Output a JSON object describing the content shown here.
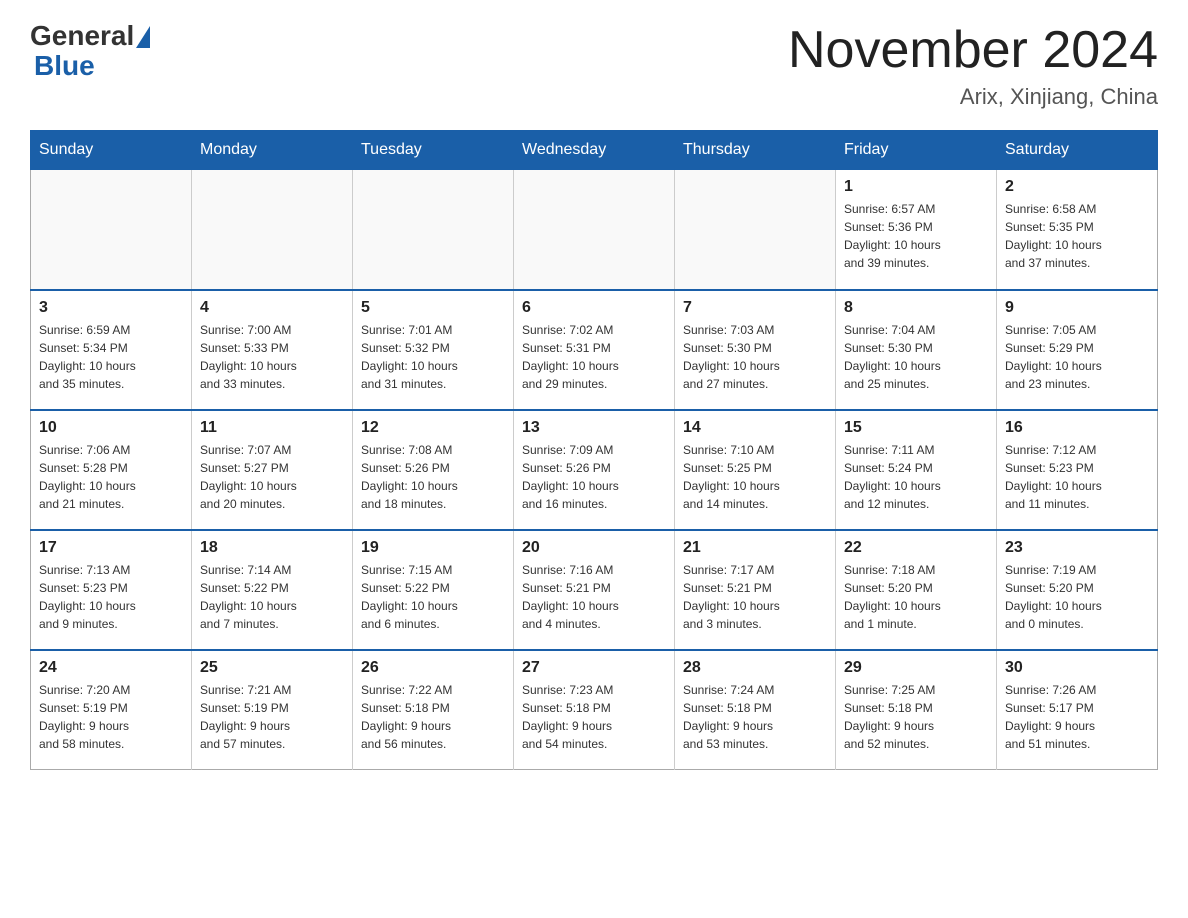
{
  "header": {
    "logo_general": "General",
    "logo_blue": "Blue",
    "month_title": "November 2024",
    "location": "Arix, Xinjiang, China"
  },
  "weekdays": [
    "Sunday",
    "Monday",
    "Tuesday",
    "Wednesday",
    "Thursday",
    "Friday",
    "Saturday"
  ],
  "weeks": [
    [
      {
        "day": "",
        "info": ""
      },
      {
        "day": "",
        "info": ""
      },
      {
        "day": "",
        "info": ""
      },
      {
        "day": "",
        "info": ""
      },
      {
        "day": "",
        "info": ""
      },
      {
        "day": "1",
        "info": "Sunrise: 6:57 AM\nSunset: 5:36 PM\nDaylight: 10 hours\nand 39 minutes."
      },
      {
        "day": "2",
        "info": "Sunrise: 6:58 AM\nSunset: 5:35 PM\nDaylight: 10 hours\nand 37 minutes."
      }
    ],
    [
      {
        "day": "3",
        "info": "Sunrise: 6:59 AM\nSunset: 5:34 PM\nDaylight: 10 hours\nand 35 minutes."
      },
      {
        "day": "4",
        "info": "Sunrise: 7:00 AM\nSunset: 5:33 PM\nDaylight: 10 hours\nand 33 minutes."
      },
      {
        "day": "5",
        "info": "Sunrise: 7:01 AM\nSunset: 5:32 PM\nDaylight: 10 hours\nand 31 minutes."
      },
      {
        "day": "6",
        "info": "Sunrise: 7:02 AM\nSunset: 5:31 PM\nDaylight: 10 hours\nand 29 minutes."
      },
      {
        "day": "7",
        "info": "Sunrise: 7:03 AM\nSunset: 5:30 PM\nDaylight: 10 hours\nand 27 minutes."
      },
      {
        "day": "8",
        "info": "Sunrise: 7:04 AM\nSunset: 5:30 PM\nDaylight: 10 hours\nand 25 minutes."
      },
      {
        "day": "9",
        "info": "Sunrise: 7:05 AM\nSunset: 5:29 PM\nDaylight: 10 hours\nand 23 minutes."
      }
    ],
    [
      {
        "day": "10",
        "info": "Sunrise: 7:06 AM\nSunset: 5:28 PM\nDaylight: 10 hours\nand 21 minutes."
      },
      {
        "day": "11",
        "info": "Sunrise: 7:07 AM\nSunset: 5:27 PM\nDaylight: 10 hours\nand 20 minutes."
      },
      {
        "day": "12",
        "info": "Sunrise: 7:08 AM\nSunset: 5:26 PM\nDaylight: 10 hours\nand 18 minutes."
      },
      {
        "day": "13",
        "info": "Sunrise: 7:09 AM\nSunset: 5:26 PM\nDaylight: 10 hours\nand 16 minutes."
      },
      {
        "day": "14",
        "info": "Sunrise: 7:10 AM\nSunset: 5:25 PM\nDaylight: 10 hours\nand 14 minutes."
      },
      {
        "day": "15",
        "info": "Sunrise: 7:11 AM\nSunset: 5:24 PM\nDaylight: 10 hours\nand 12 minutes."
      },
      {
        "day": "16",
        "info": "Sunrise: 7:12 AM\nSunset: 5:23 PM\nDaylight: 10 hours\nand 11 minutes."
      }
    ],
    [
      {
        "day": "17",
        "info": "Sunrise: 7:13 AM\nSunset: 5:23 PM\nDaylight: 10 hours\nand 9 minutes."
      },
      {
        "day": "18",
        "info": "Sunrise: 7:14 AM\nSunset: 5:22 PM\nDaylight: 10 hours\nand 7 minutes."
      },
      {
        "day": "19",
        "info": "Sunrise: 7:15 AM\nSunset: 5:22 PM\nDaylight: 10 hours\nand 6 minutes."
      },
      {
        "day": "20",
        "info": "Sunrise: 7:16 AM\nSunset: 5:21 PM\nDaylight: 10 hours\nand 4 minutes."
      },
      {
        "day": "21",
        "info": "Sunrise: 7:17 AM\nSunset: 5:21 PM\nDaylight: 10 hours\nand 3 minutes."
      },
      {
        "day": "22",
        "info": "Sunrise: 7:18 AM\nSunset: 5:20 PM\nDaylight: 10 hours\nand 1 minute."
      },
      {
        "day": "23",
        "info": "Sunrise: 7:19 AM\nSunset: 5:20 PM\nDaylight: 10 hours\nand 0 minutes."
      }
    ],
    [
      {
        "day": "24",
        "info": "Sunrise: 7:20 AM\nSunset: 5:19 PM\nDaylight: 9 hours\nand 58 minutes."
      },
      {
        "day": "25",
        "info": "Sunrise: 7:21 AM\nSunset: 5:19 PM\nDaylight: 9 hours\nand 57 minutes."
      },
      {
        "day": "26",
        "info": "Sunrise: 7:22 AM\nSunset: 5:18 PM\nDaylight: 9 hours\nand 56 minutes."
      },
      {
        "day": "27",
        "info": "Sunrise: 7:23 AM\nSunset: 5:18 PM\nDaylight: 9 hours\nand 54 minutes."
      },
      {
        "day": "28",
        "info": "Sunrise: 7:24 AM\nSunset: 5:18 PM\nDaylight: 9 hours\nand 53 minutes."
      },
      {
        "day": "29",
        "info": "Sunrise: 7:25 AM\nSunset: 5:18 PM\nDaylight: 9 hours\nand 52 minutes."
      },
      {
        "day": "30",
        "info": "Sunrise: 7:26 AM\nSunset: 5:17 PM\nDaylight: 9 hours\nand 51 minutes."
      }
    ]
  ]
}
